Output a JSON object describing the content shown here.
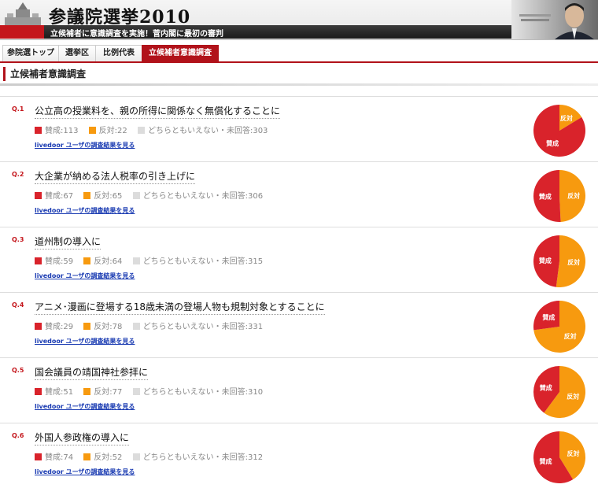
{
  "header": {
    "title": "参議院選挙2010",
    "subtitle": "立候補者に意識調査を実施！菅内閣に最初の審判"
  },
  "nav": {
    "tabs": [
      {
        "label": "参院選トップ",
        "active": false
      },
      {
        "label": "選挙区",
        "active": false
      },
      {
        "label": "比例代表",
        "active": false
      },
      {
        "label": "立候補者意識調査",
        "active": true
      }
    ]
  },
  "section_title": "立候補者意識調査",
  "labels": {
    "yes": "賛成",
    "no": "反対",
    "other": "どちらともいえない・未回答",
    "link": "livedoor ユーザの調査結果を見る"
  },
  "colors": {
    "yes": "#d9232b",
    "no": "#f79a0f",
    "other": "#dcdcdc",
    "accent": "#b1121a"
  },
  "questions": [
    {
      "num": "Q.1",
      "text": "公立高の授業料を、親の所得に関係なく無償化することに",
      "yes": 113,
      "no": 22,
      "other": 303
    },
    {
      "num": "Q.2",
      "text": "大企業が納める法人税率の引き上げに",
      "yes": 67,
      "no": 65,
      "other": 306
    },
    {
      "num": "Q.3",
      "text": "道州制の導入に",
      "yes": 59,
      "no": 64,
      "other": 315
    },
    {
      "num": "Q.4",
      "text": "アニメ･漫画に登場する18歳未満の登場人物も規制対象とすることに",
      "yes": 29,
      "no": 78,
      "other": 331
    },
    {
      "num": "Q.5",
      "text": "国会議員の靖国神社参拝に",
      "yes": 51,
      "no": 77,
      "other": 310
    },
    {
      "num": "Q.6",
      "text": "外国人参政権の導入に",
      "yes": 74,
      "no": 52,
      "other": 312
    }
  ]
}
